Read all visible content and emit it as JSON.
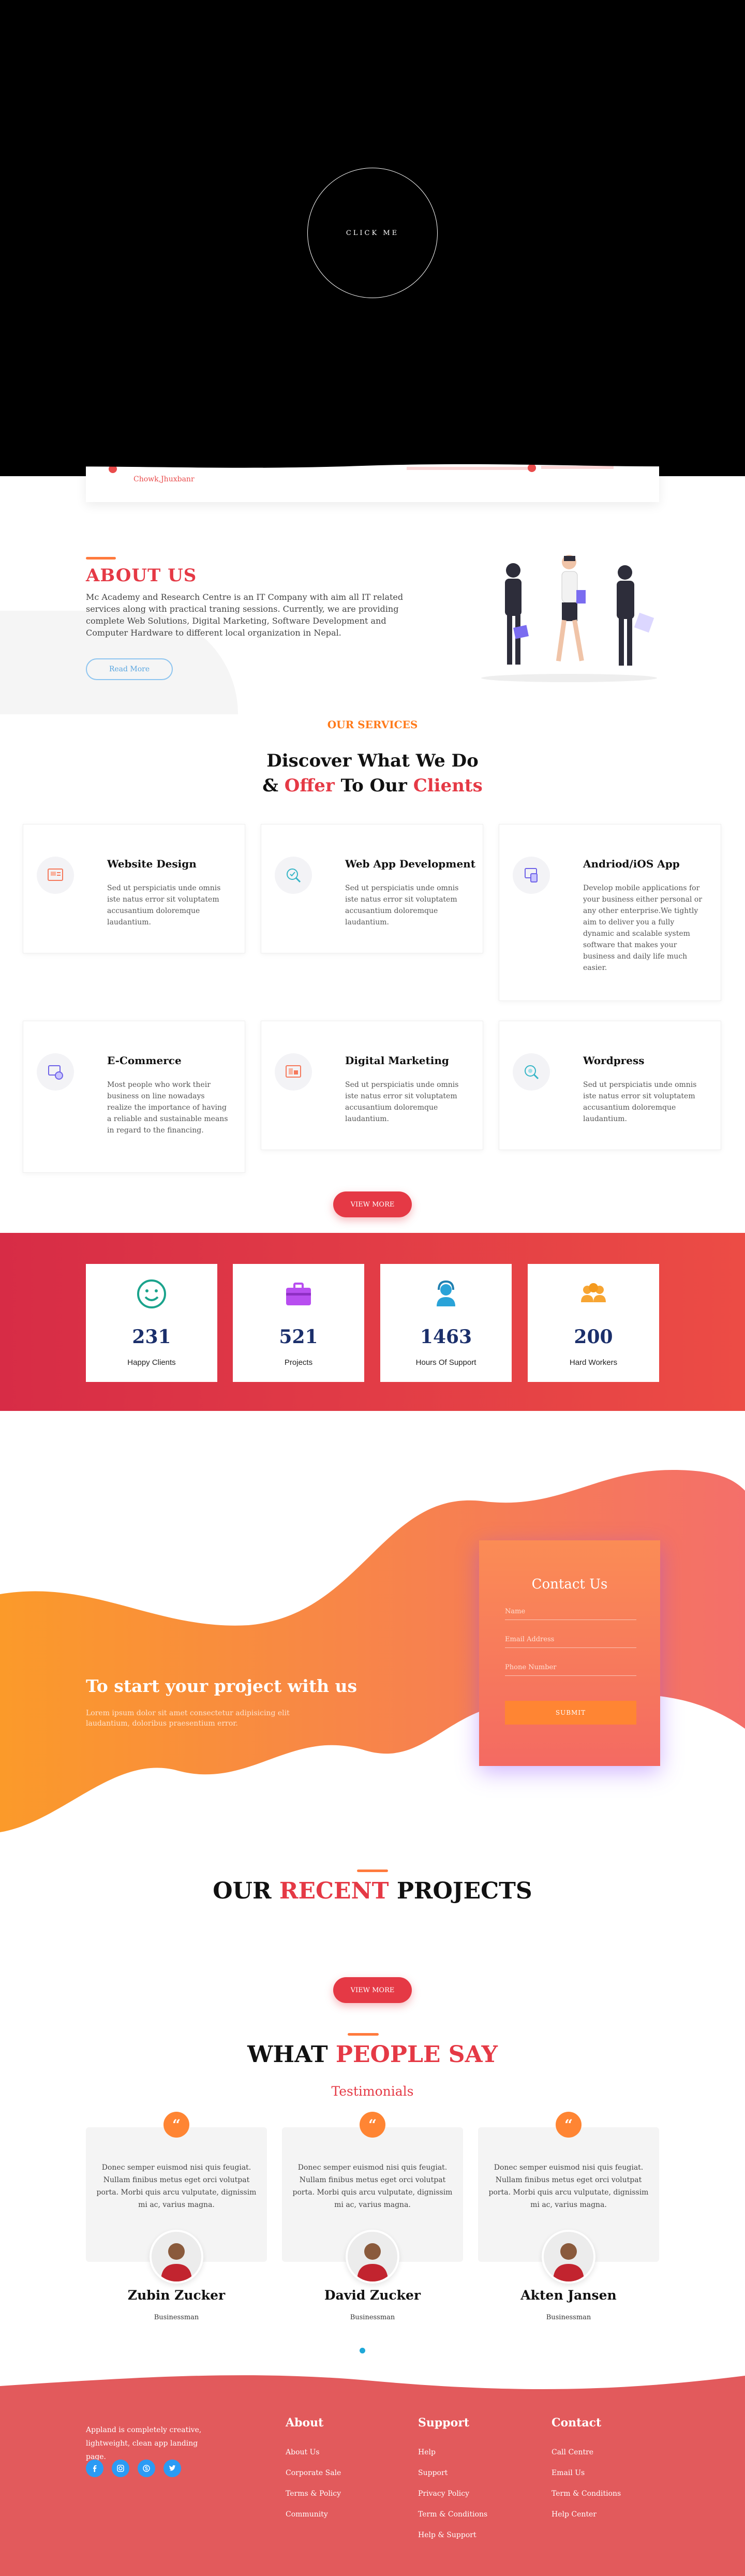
{
  "hero": {
    "button_label": "CLICK ME"
  },
  "strip": {
    "text": "Chowk,Jhuxbanr"
  },
  "about": {
    "title": "ABOUT US",
    "text": "Mc Academy and Research Centre is an IT Company with aim all IT related services along with practical traning sessions. Currently, we are providing complete Web Solutions, Digital Marketing, Software Development and Computer Hardware to different local organization in Nepal.",
    "button": "Read More"
  },
  "services": {
    "subtitle": "OUR SERVICES",
    "title_line1": "Discover What We Do",
    "title_amp": "& ",
    "title_offer": "Offer",
    "title_mid": " To Our ",
    "title_clients": "Clients",
    "items": [
      {
        "title": "Website Design",
        "text": "Sed ut perspiciatis unde omnis iste natus error sit voluptatem accusantium doloremque laudantium.",
        "icon": "web-design-icon"
      },
      {
        "title": "Web App Development",
        "text": "Sed ut perspiciatis unde omnis iste natus error sit voluptatem accusantium doloremque laudantium.",
        "icon": "web-app-icon"
      },
      {
        "title": "Andriod/iOS App",
        "text": "Develop mobile applications for your business either personal or any other enterprise.We tightly aim to deliver you a fully dynamic and scalable system software that makes your business and daily life much easier.",
        "icon": "mobile-app-icon"
      },
      {
        "title": "E-Commerce",
        "text": "Most people who work their business on line nowadays realize the importance of having a reliable and sustainable means in regard to the financing.",
        "icon": "ecommerce-icon"
      },
      {
        "title": "Digital Marketing",
        "text": "Sed ut perspiciatis unde omnis iste natus error sit voluptatem accusantium doloremque laudantium.",
        "icon": "digital-marketing-icon"
      },
      {
        "title": "Wordpress",
        "text": "Sed ut perspiciatis unde omnis iste natus error sit voluptatem accusantium doloremque laudantium.",
        "icon": "wordpress-icon"
      }
    ],
    "button": "VIEW MORE"
  },
  "stats": [
    {
      "value": "231",
      "label": "Happy Clients",
      "icon": "smiley-icon",
      "color": "#1aa38c"
    },
    {
      "value": "521",
      "label": "Projects",
      "icon": "briefcase-icon",
      "color": "#b84ef0"
    },
    {
      "value": "1463",
      "label": "Hours Of Support",
      "icon": "support-icon",
      "color": "#2aa3d8"
    },
    {
      "value": "200",
      "label": "Hard Workers",
      "icon": "team-icon",
      "color": "#f7a533"
    }
  ],
  "cta": {
    "title": "To start your project with us",
    "text": "Lorem ipsum dolor sit amet consectetur adipisicing elit laudantium, doloribus praesentium error."
  },
  "contact": {
    "title": "Contact Us",
    "name_placeholder": "Name",
    "email_placeholder": "Email Address",
    "phone_placeholder": "Phone Number",
    "submit": "SUBMIT"
  },
  "projects": {
    "title_a": "OUR ",
    "title_b": "RECENT",
    "title_c": " PROJECTS",
    "button": "VIEW MORE"
  },
  "testimonials": {
    "title_a": "WHAT ",
    "title_b": "PEOPLE SAY",
    "subtitle": "Testimonials",
    "quote_mark": "“",
    "items": [
      {
        "text": "Donec semper euismod nisi quis feugiat. Nullam finibus metus eget orci volutpat porta. Morbi quis arcu vulputate, dignissim mi ac, varius magna.",
        "name": "Zubin Zucker",
        "role": "Businessman"
      },
      {
        "text": "Donec semper euismod nisi quis feugiat. Nullam finibus metus eget orci volutpat porta. Morbi quis arcu vulputate, dignissim mi ac, varius magna.",
        "name": "David Zucker",
        "role": "Businessman"
      },
      {
        "text": "Donec semper euismod nisi quis feugiat. Nullam finibus metus eget orci volutpat porta. Morbi quis arcu vulputate, dignissim mi ac, varius magna.",
        "name": "Akten Jansen",
        "role": "Businessman"
      }
    ]
  },
  "footer": {
    "description": "Appland is completely creative, lightweight, clean app landing page.",
    "social": [
      "facebook-icon",
      "instagram-icon",
      "skype-icon",
      "twitter-icon"
    ],
    "columns": [
      {
        "title": "About",
        "links": [
          "About Us",
          "Corporate Sale",
          "Terms & Policy",
          "Community"
        ]
      },
      {
        "title": "Support",
        "links": [
          "Help",
          "Support",
          "Privacy Policy",
          "Term & Conditions",
          "Help & Support"
        ]
      },
      {
        "title": "Contact",
        "links": [
          "Call Centre",
          "Email Us",
          "Term & Conditions",
          "Help Center"
        ]
      }
    ],
    "bg_color": "#e25a5c"
  }
}
